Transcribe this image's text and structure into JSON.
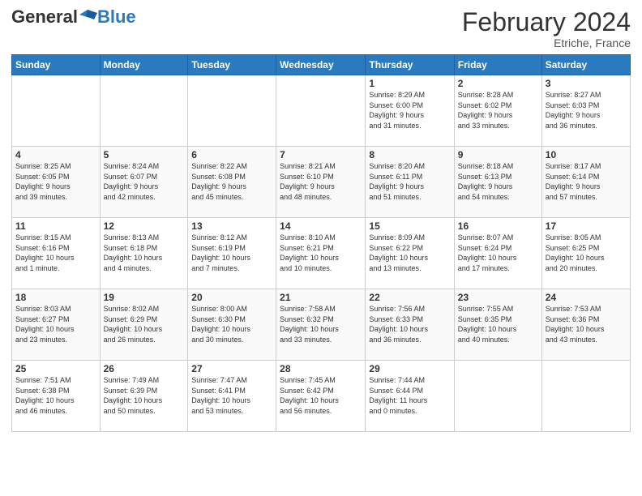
{
  "header": {
    "logo": {
      "general": "General",
      "blue": "Blue",
      "alt": "GeneralBlue logo"
    },
    "title": "February 2024",
    "location": "Etriche, France"
  },
  "days_of_week": [
    "Sunday",
    "Monday",
    "Tuesday",
    "Wednesday",
    "Thursday",
    "Friday",
    "Saturday"
  ],
  "weeks": [
    [
      {
        "day": "",
        "info": ""
      },
      {
        "day": "",
        "info": ""
      },
      {
        "day": "",
        "info": ""
      },
      {
        "day": "",
        "info": ""
      },
      {
        "day": "1",
        "info": "Sunrise: 8:29 AM\nSunset: 6:00 PM\nDaylight: 9 hours\nand 31 minutes."
      },
      {
        "day": "2",
        "info": "Sunrise: 8:28 AM\nSunset: 6:02 PM\nDaylight: 9 hours\nand 33 minutes."
      },
      {
        "day": "3",
        "info": "Sunrise: 8:27 AM\nSunset: 6:03 PM\nDaylight: 9 hours\nand 36 minutes."
      }
    ],
    [
      {
        "day": "4",
        "info": "Sunrise: 8:25 AM\nSunset: 6:05 PM\nDaylight: 9 hours\nand 39 minutes."
      },
      {
        "day": "5",
        "info": "Sunrise: 8:24 AM\nSunset: 6:07 PM\nDaylight: 9 hours\nand 42 minutes."
      },
      {
        "day": "6",
        "info": "Sunrise: 8:22 AM\nSunset: 6:08 PM\nDaylight: 9 hours\nand 45 minutes."
      },
      {
        "day": "7",
        "info": "Sunrise: 8:21 AM\nSunset: 6:10 PM\nDaylight: 9 hours\nand 48 minutes."
      },
      {
        "day": "8",
        "info": "Sunrise: 8:20 AM\nSunset: 6:11 PM\nDaylight: 9 hours\nand 51 minutes."
      },
      {
        "day": "9",
        "info": "Sunrise: 8:18 AM\nSunset: 6:13 PM\nDaylight: 9 hours\nand 54 minutes."
      },
      {
        "day": "10",
        "info": "Sunrise: 8:17 AM\nSunset: 6:14 PM\nDaylight: 9 hours\nand 57 minutes."
      }
    ],
    [
      {
        "day": "11",
        "info": "Sunrise: 8:15 AM\nSunset: 6:16 PM\nDaylight: 10 hours\nand 1 minute."
      },
      {
        "day": "12",
        "info": "Sunrise: 8:13 AM\nSunset: 6:18 PM\nDaylight: 10 hours\nand 4 minutes."
      },
      {
        "day": "13",
        "info": "Sunrise: 8:12 AM\nSunset: 6:19 PM\nDaylight: 10 hours\nand 7 minutes."
      },
      {
        "day": "14",
        "info": "Sunrise: 8:10 AM\nSunset: 6:21 PM\nDaylight: 10 hours\nand 10 minutes."
      },
      {
        "day": "15",
        "info": "Sunrise: 8:09 AM\nSunset: 6:22 PM\nDaylight: 10 hours\nand 13 minutes."
      },
      {
        "day": "16",
        "info": "Sunrise: 8:07 AM\nSunset: 6:24 PM\nDaylight: 10 hours\nand 17 minutes."
      },
      {
        "day": "17",
        "info": "Sunrise: 8:05 AM\nSunset: 6:25 PM\nDaylight: 10 hours\nand 20 minutes."
      }
    ],
    [
      {
        "day": "18",
        "info": "Sunrise: 8:03 AM\nSunset: 6:27 PM\nDaylight: 10 hours\nand 23 minutes."
      },
      {
        "day": "19",
        "info": "Sunrise: 8:02 AM\nSunset: 6:29 PM\nDaylight: 10 hours\nand 26 minutes."
      },
      {
        "day": "20",
        "info": "Sunrise: 8:00 AM\nSunset: 6:30 PM\nDaylight: 10 hours\nand 30 minutes."
      },
      {
        "day": "21",
        "info": "Sunrise: 7:58 AM\nSunset: 6:32 PM\nDaylight: 10 hours\nand 33 minutes."
      },
      {
        "day": "22",
        "info": "Sunrise: 7:56 AM\nSunset: 6:33 PM\nDaylight: 10 hours\nand 36 minutes."
      },
      {
        "day": "23",
        "info": "Sunrise: 7:55 AM\nSunset: 6:35 PM\nDaylight: 10 hours\nand 40 minutes."
      },
      {
        "day": "24",
        "info": "Sunrise: 7:53 AM\nSunset: 6:36 PM\nDaylight: 10 hours\nand 43 minutes."
      }
    ],
    [
      {
        "day": "25",
        "info": "Sunrise: 7:51 AM\nSunset: 6:38 PM\nDaylight: 10 hours\nand 46 minutes."
      },
      {
        "day": "26",
        "info": "Sunrise: 7:49 AM\nSunset: 6:39 PM\nDaylight: 10 hours\nand 50 minutes."
      },
      {
        "day": "27",
        "info": "Sunrise: 7:47 AM\nSunset: 6:41 PM\nDaylight: 10 hours\nand 53 minutes."
      },
      {
        "day": "28",
        "info": "Sunrise: 7:45 AM\nSunset: 6:42 PM\nDaylight: 10 hours\nand 56 minutes."
      },
      {
        "day": "29",
        "info": "Sunrise: 7:44 AM\nSunset: 6:44 PM\nDaylight: 11 hours\nand 0 minutes."
      },
      {
        "day": "",
        "info": ""
      },
      {
        "day": "",
        "info": ""
      }
    ]
  ]
}
